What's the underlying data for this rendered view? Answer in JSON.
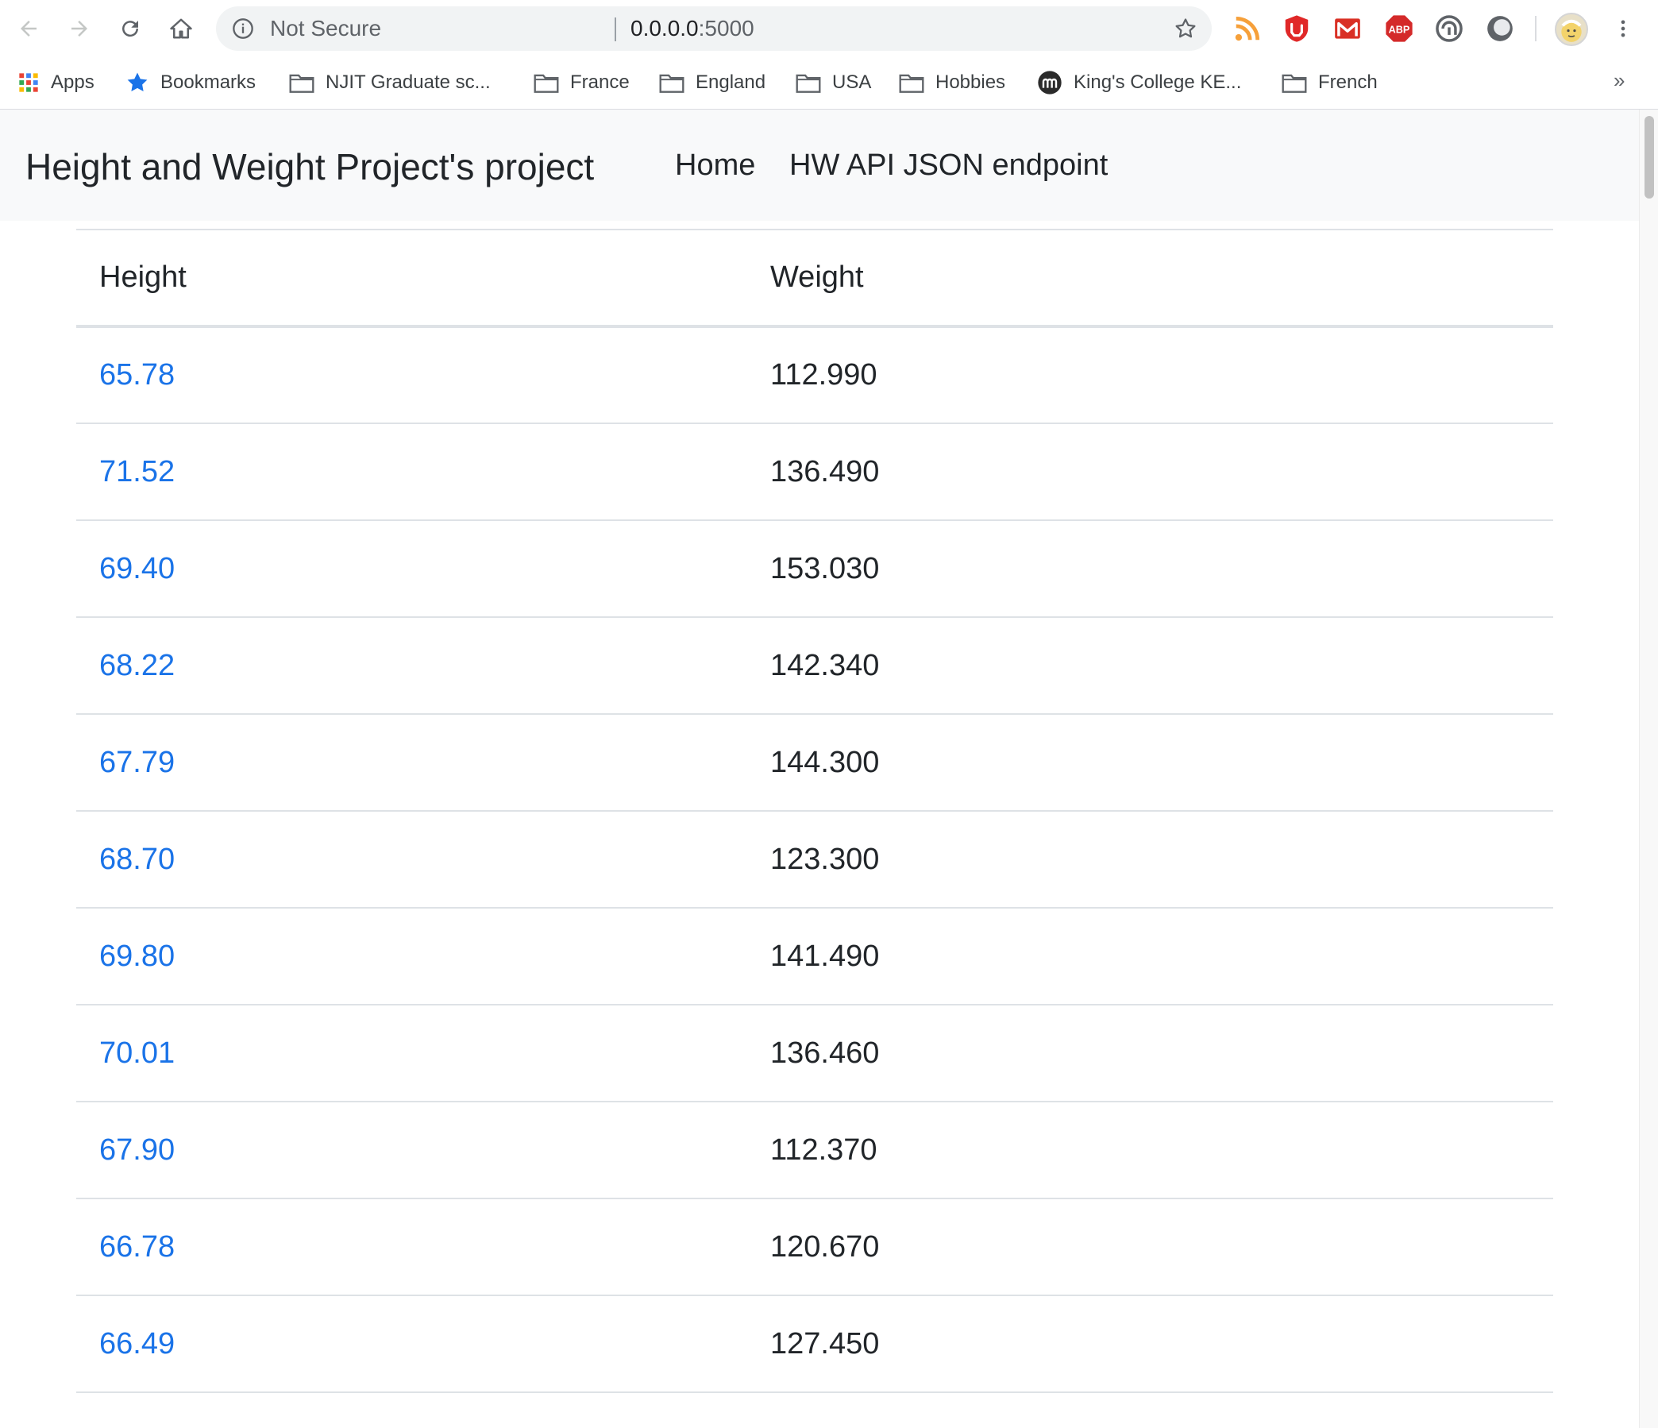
{
  "browser": {
    "security_label": "Not Secure",
    "url_host": "0.0.0.0",
    "url_port": ":5000"
  },
  "bookmarks": {
    "items": [
      {
        "label": "Apps",
        "icon": "apps-grid-icon"
      },
      {
        "label": "Bookmarks",
        "icon": "star-icon"
      },
      {
        "label": "NJIT Graduate sc...",
        "icon": "folder-icon"
      },
      {
        "label": "France",
        "icon": "folder-icon"
      },
      {
        "label": "England",
        "icon": "folder-icon"
      },
      {
        "label": "USA",
        "icon": "folder-icon"
      },
      {
        "label": "Hobbies",
        "icon": "folder-icon"
      },
      {
        "label": "King's College KE...",
        "icon": "moodle-icon"
      },
      {
        "label": "French",
        "icon": "folder-icon"
      }
    ],
    "more": "»"
  },
  "navbar": {
    "brand": "Height and Weight Project's project",
    "links": [
      "Home",
      "HW API JSON endpoint"
    ]
  },
  "table": {
    "headers": [
      "Height",
      "Weight"
    ],
    "rows": [
      {
        "height": "65.78",
        "weight": "112.990"
      },
      {
        "height": "71.52",
        "weight": "136.490"
      },
      {
        "height": "69.40",
        "weight": "153.030"
      },
      {
        "height": "68.22",
        "weight": "142.340"
      },
      {
        "height": "67.79",
        "weight": "144.300"
      },
      {
        "height": "68.70",
        "weight": "123.300"
      },
      {
        "height": "69.80",
        "weight": "141.490"
      },
      {
        "height": "70.01",
        "weight": "136.460"
      },
      {
        "height": "67.90",
        "weight": "112.370"
      },
      {
        "height": "66.78",
        "weight": "120.670"
      },
      {
        "height": "66.49",
        "weight": "127.450"
      }
    ]
  },
  "colors": {
    "link": "#1a73e8",
    "navbar_bg": "#f8f9fa",
    "rss": "#f6a03a",
    "stop": "#e02828",
    "gmail": "#d93025",
    "abp": "#d42a2a"
  }
}
